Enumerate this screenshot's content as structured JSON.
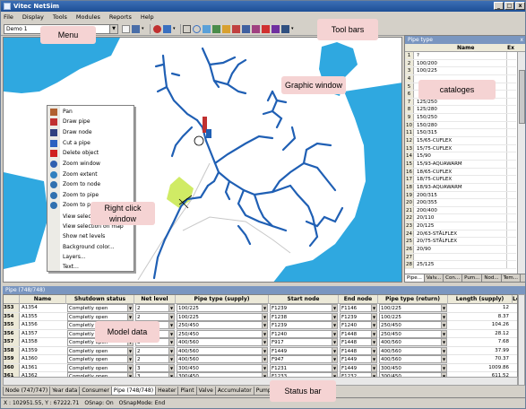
{
  "window": {
    "title": "Vitec NetSim",
    "minimize": "_",
    "maximize": "□",
    "close": "x"
  },
  "menu": [
    "File",
    "Display",
    "Tools",
    "Modules",
    "Reports",
    "Help"
  ],
  "toolbar": {
    "combo_value": "Demo 1"
  },
  "annotations": {
    "menu": "Menu",
    "toolbars": "Tool bars",
    "graphic_window": "Graphic window",
    "catalogues": "cataloges",
    "right_click": "Right click window",
    "model_data": "Model data",
    "status_bar": "Status bar"
  },
  "context_menu": [
    {
      "label": "Pan",
      "icon": "hand-icon"
    },
    {
      "label": "Draw pipe",
      "icon": "draw-pipe-icon"
    },
    {
      "label": "Draw node",
      "icon": "draw-node-icon"
    },
    {
      "label": "Cut a pipe",
      "icon": "scissors-icon"
    },
    {
      "label": "Delete object",
      "icon": "delete-icon"
    },
    {
      "label": "Zoom window",
      "icon": "zoom-window-icon"
    },
    {
      "label": "Zoom extent",
      "icon": "zoom-extent-icon"
    },
    {
      "label": "Zoom to node",
      "icon": "zoom-node-icon"
    },
    {
      "label": "Zoom to pipe",
      "icon": "zoom-pipe-icon"
    },
    {
      "label": "Zoom to pre",
      "icon": "zoom-previous-icon"
    },
    {
      "label": "View selectio",
      "icon": ""
    },
    {
      "label": "View selection on map",
      "icon": ""
    },
    {
      "label": "Show net levels",
      "icon": ""
    },
    {
      "label": "Background color...",
      "icon": ""
    },
    {
      "label": "Layers...",
      "icon": ""
    },
    {
      "label": "Text...",
      "icon": ""
    }
  ],
  "catalog_panel": {
    "title": "Pipe type",
    "close": "x",
    "col_name": "Name",
    "col_ex": "Ex",
    "rows": [
      {
        "n": "1",
        "v": "?"
      },
      {
        "n": "2",
        "v": "100/200"
      },
      {
        "n": "3",
        "v": "100/225"
      },
      {
        "n": "4",
        "v": ""
      },
      {
        "n": "5",
        "v": ""
      },
      {
        "n": "6",
        "v": ""
      },
      {
        "n": "7",
        "v": "125/250"
      },
      {
        "n": "8",
        "v": "125/280"
      },
      {
        "n": "9",
        "v": "150/250"
      },
      {
        "n": "10",
        "v": "150/280"
      },
      {
        "n": "11",
        "v": "150/315"
      },
      {
        "n": "12",
        "v": "15/65-CUFLEX"
      },
      {
        "n": "13",
        "v": "15/75-CUFLEX"
      },
      {
        "n": "14",
        "v": "15/90"
      },
      {
        "n": "15",
        "v": "15/93-AQUAWARM"
      },
      {
        "n": "16",
        "v": "18/65-CUFLEX"
      },
      {
        "n": "17",
        "v": "18/75-CUFLEX"
      },
      {
        "n": "18",
        "v": "18/93-AQUAWARM"
      },
      {
        "n": "19",
        "v": "200/315"
      },
      {
        "n": "20",
        "v": "200/355"
      },
      {
        "n": "21",
        "v": "200/400"
      },
      {
        "n": "22",
        "v": "20/110"
      },
      {
        "n": "23",
        "v": "20/125"
      },
      {
        "n": "24",
        "v": "20/63-STÅLFLEX"
      },
      {
        "n": "25",
        "v": "20/75-STÅLFLEX"
      },
      {
        "n": "26",
        "v": "20/90"
      },
      {
        "n": "27",
        "v": ""
      },
      {
        "n": "28",
        "v": "25/125"
      }
    ],
    "tabs": [
      "Pipe...",
      "Valv...",
      "Con...",
      "Pum...",
      "Nod...",
      "Tem..."
    ]
  },
  "model": {
    "title": "Pipe (748/748)",
    "columns": [
      "",
      "Name",
      "Shutdown status",
      "Net level",
      "Pipe type (supply)",
      "Start node",
      "End node",
      "Pipe type (return)",
      "Length (supply)",
      "Le"
    ],
    "rows": [
      {
        "id": "353",
        "name": "A1354",
        "status": "Completly open",
        "level": "2",
        "supply": "100/225",
        "start": "F1239",
        "end": "F1146",
        "ret": "100/225",
        "len": "12"
      },
      {
        "id": "354",
        "name": "A1355",
        "status": "Completly open",
        "level": "2",
        "supply": "100/225",
        "start": "F1238",
        "end": "F1239",
        "ret": "100/225",
        "len": "8.37"
      },
      {
        "id": "355",
        "name": "A1356",
        "status": "Completly open",
        "level": "2",
        "supply": "250/450",
        "start": "F1239",
        "end": "F1240",
        "ret": "250/450",
        "len": "104.26"
      },
      {
        "id": "356",
        "name": "A1357",
        "status": "Completly open",
        "level": "2",
        "supply": "250/450",
        "start": "F1240",
        "end": "F1448",
        "ret": "250/450",
        "len": "28.12"
      },
      {
        "id": "357",
        "name": "A1358",
        "status": "Completly open",
        "level": "3",
        "supply": "400/560",
        "start": "F917",
        "end": "F1448",
        "ret": "400/560",
        "len": "7.68"
      },
      {
        "id": "358",
        "name": "A1359",
        "status": "Completly open",
        "level": "2",
        "supply": "400/560",
        "start": "F1449",
        "end": "F1448",
        "ret": "400/560",
        "len": "37.99"
      },
      {
        "id": "359",
        "name": "A1360",
        "status": "Completly open",
        "level": "2",
        "supply": "400/560",
        "start": "F947",
        "end": "F1449",
        "ret": "400/560",
        "len": "70.37"
      },
      {
        "id": "360",
        "name": "A1361",
        "status": "Completly open",
        "level": "3",
        "supply": "300/450",
        "start": "F1231",
        "end": "F1449",
        "ret": "300/450",
        "len": "1009.86"
      },
      {
        "id": "361",
        "name": "A1362",
        "status": "Completly open",
        "level": "3",
        "supply": "300/450",
        "start": "F1233",
        "end": "F1232",
        "ret": "300/450",
        "len": "611.52"
      }
    ]
  },
  "bottom_tabs": [
    "Node (747/747)",
    "Year data",
    "Consumer",
    "Pipe (748/748)",
    "Heater",
    "Plant",
    "Valve",
    "Accumulator",
    "Pump"
  ],
  "active_bottom_tab": 3,
  "status": {
    "coords": "X : 102951.55, Y : 67222.71",
    "osnap": "OSnap: On",
    "osnapmode": "OSnapMode: End"
  },
  "colors": {
    "pipe": "#1f5fb4",
    "water": "#2fa8e0",
    "highlight": "#c8e84a",
    "callout": "#f5d3d3",
    "title": "#1d4f96"
  }
}
